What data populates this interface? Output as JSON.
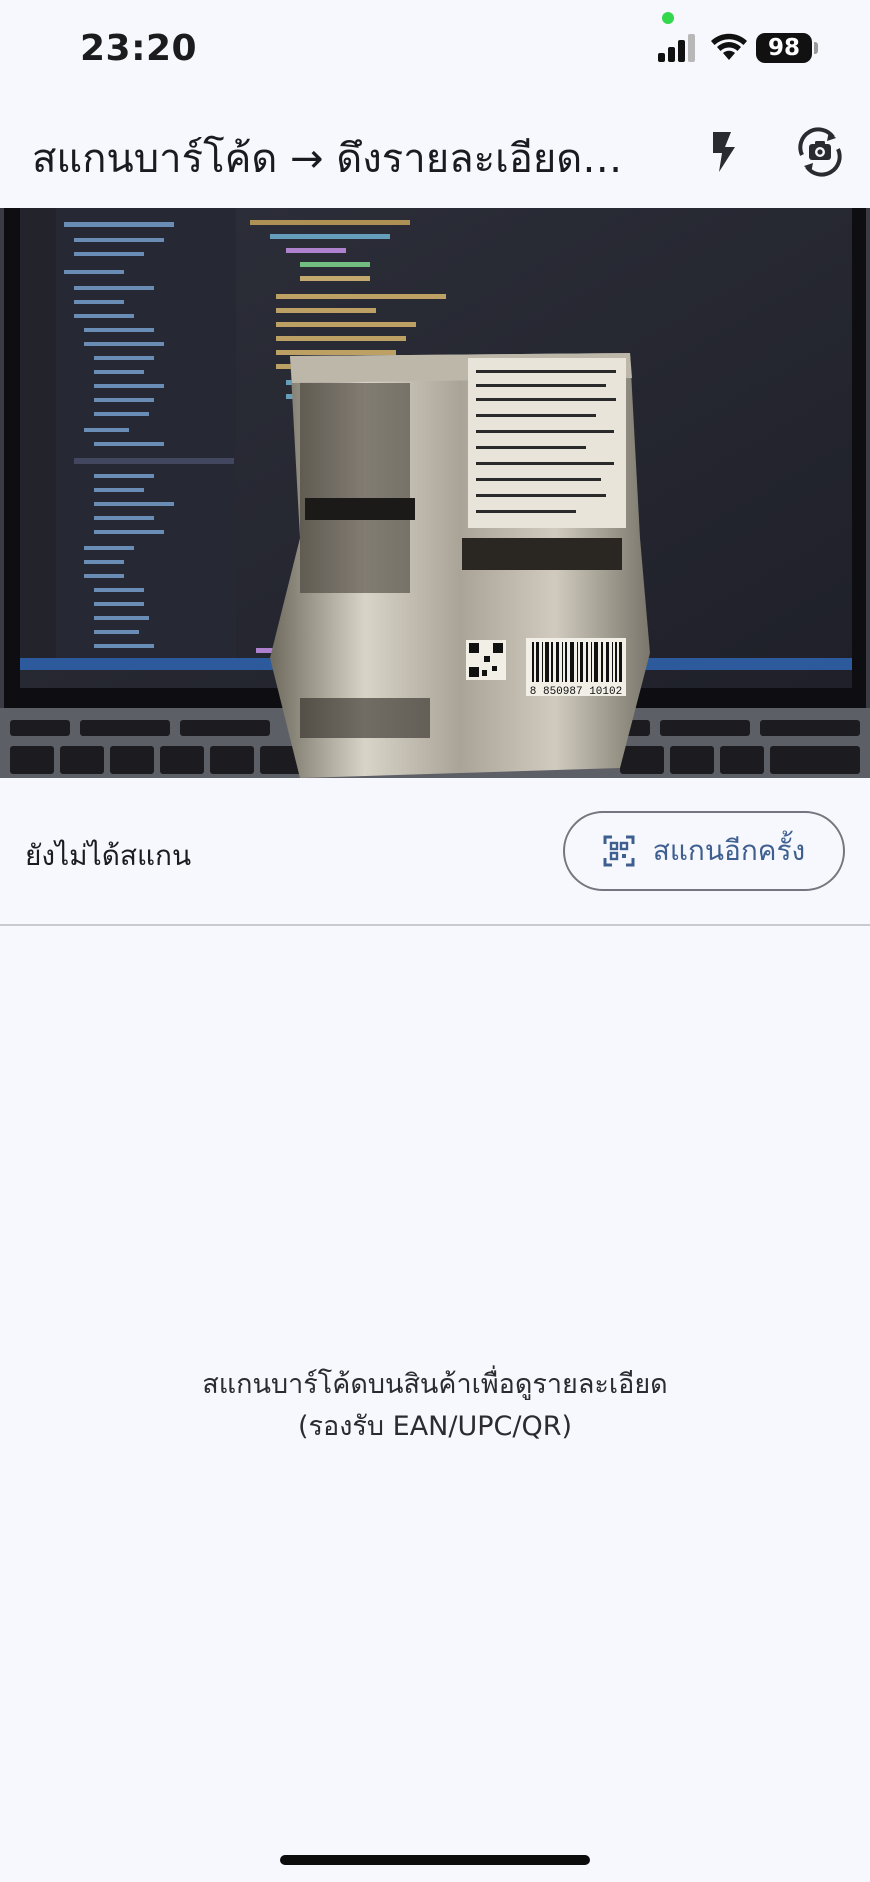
{
  "status_bar": {
    "time": "23:20",
    "battery": "98"
  },
  "app_bar": {
    "title": "สแกนบาร์โค้ด → ดึงรายละเอียดสินค้า",
    "icons": {
      "flash": "flash-icon",
      "switch_camera": "switch-camera-icon"
    }
  },
  "scan": {
    "status": "ยังไม่ได้สแกน",
    "rescan_label": "สแกนอีกครั้ง",
    "rescan_icon": "qr-scan-icon"
  },
  "empty_state": {
    "line1": "สแกนบาร์โค้ดบนสินค้าเพื่อดูรายละเอียด",
    "line2": "(รองรับ EAN/UPC/QR)"
  },
  "camera": {
    "barcode_digits": "8 850987 10102"
  },
  "colors": {
    "accent": "#3f5f90",
    "background": "#f7f8fd",
    "outline": "#74777f"
  }
}
